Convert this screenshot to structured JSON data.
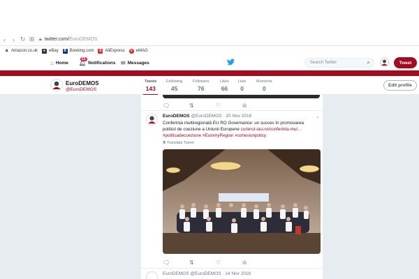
{
  "browser": {
    "url_host": "twitter.com/",
    "url_path": "EuroDEMOS",
    "bookmarks": [
      "Amazon.co.uk",
      "eBay",
      "Booking.com",
      "AliExpress",
      "eMAG"
    ]
  },
  "twitter_nav": {
    "home": "Home",
    "notifications": "Notifications",
    "notifications_count": "21",
    "messages": "Messages",
    "search_placeholder": "Search Twitter",
    "tweet_button": "Tweet"
  },
  "profile": {
    "name": "EuroDEMOS",
    "handle": "@EuroDEMOS",
    "edit_button": "Edit profile",
    "stats": [
      {
        "label": "Tweets",
        "value": "143"
      },
      {
        "label": "Following",
        "value": "45"
      },
      {
        "label": "Followers",
        "value": "76"
      },
      {
        "label": "Likes",
        "value": "66"
      },
      {
        "label": "Lists",
        "value": "0"
      },
      {
        "label": "Moments",
        "value": "0"
      }
    ]
  },
  "tweet": {
    "author": "EuroDEMOS",
    "meta": "@EuroDEMOS · 20 Nov 2018",
    "text_plain": "Conferința multiregională EU RO Governance: un succes în promovarea politicii de coeziune a Uniunii Europene ",
    "link": "curierul-iasi.ro/conferinta-mul…",
    "hashtags": "#politicadecoeziune #EuinmyRegion #cohesionpolicy",
    "translate": "Translate Tweet"
  },
  "next_tweet": {
    "meta": "EuroDEMOS @EuroDEMOS · 14 Nov 2018"
  },
  "colors": {
    "brand": "#a30c1f",
    "background": "#e6ecf0"
  }
}
